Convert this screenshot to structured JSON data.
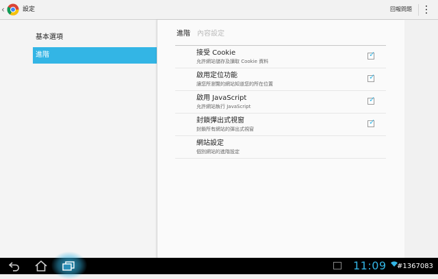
{
  "action_bar": {
    "title": "設定",
    "feedback_label": "回報問題"
  },
  "left_nav": {
    "items": [
      {
        "label": "基本選項",
        "selected": false
      },
      {
        "label": "進階",
        "selected": true
      }
    ]
  },
  "content": {
    "breadcrumb": {
      "main": "進階",
      "sub": "內容設定"
    },
    "settings": [
      {
        "title": "接受 Cookie",
        "summary": "允許網站儲存及讀取 Cookie 資料",
        "checked": true
      },
      {
        "title": "啟用定位功能",
        "summary": "讓您所瀏覽的網站知道您的所在位置",
        "checked": true
      },
      {
        "title": "啟用 JavaScript",
        "summary": "允許網站執行 JavaScript",
        "checked": true
      },
      {
        "title": "封鎖彈出式視窗",
        "summary": "封鎖所有網站的彈出式視窗",
        "checked": true
      },
      {
        "title": "網站設定",
        "summary": "個別網站的進階設定"
      }
    ]
  },
  "system_bar": {
    "clock": "11:09",
    "watermark": "#1367083"
  },
  "colors": {
    "accent": "#33b5e5",
    "action_bar_bg": "#f2f2f2",
    "pane_bg": "#fafafa",
    "nav_bar_bg": "#000000"
  },
  "icons": {
    "back": "back-chevron-icon",
    "app": "chrome-logo-icon",
    "overflow": "overflow-menu-icon",
    "nav_back": "back-arrow-icon",
    "nav_home": "home-icon",
    "nav_recent": "recent-apps-icon",
    "gallery": "gallery-icon",
    "wifi": "wifi-icon"
  }
}
